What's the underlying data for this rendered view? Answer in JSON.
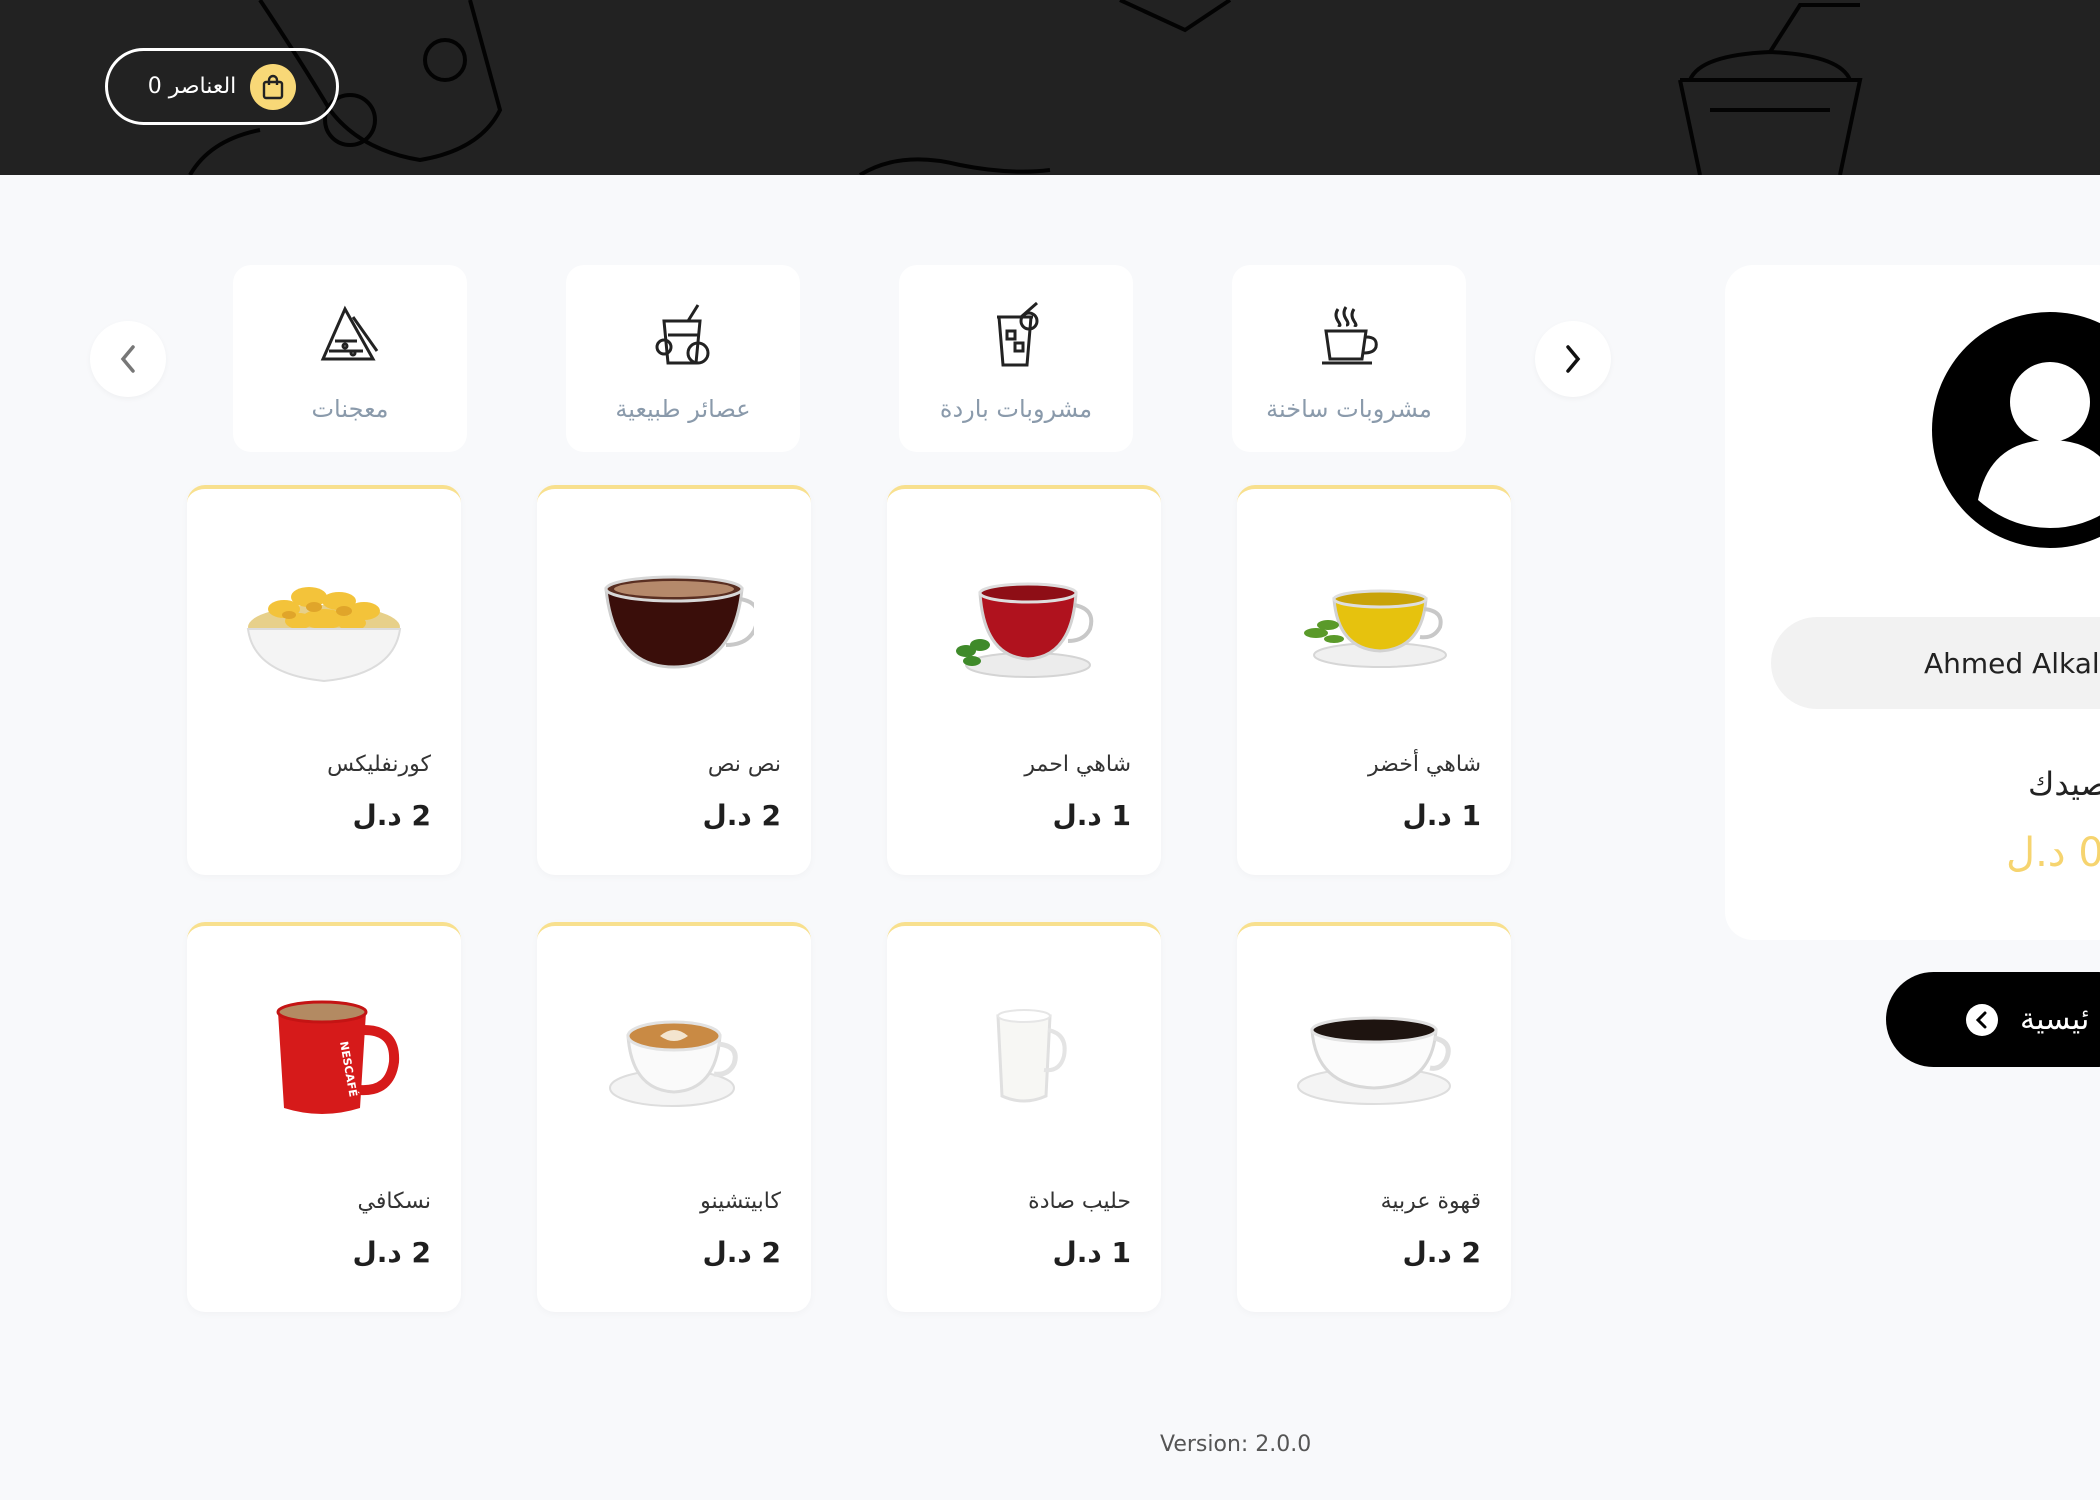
{
  "header": {
    "cart": {
      "label": "العناصر",
      "count": "0"
    }
  },
  "categories": [
    {
      "label": "مشروبات ساخنة",
      "icon": "hot-drink-icon"
    },
    {
      "label": "مشروبات باردة",
      "icon": "cold-drink-icon"
    },
    {
      "label": "عصائر طبيعية",
      "icon": "juice-icon"
    },
    {
      "label": "معجنات",
      "icon": "sandwich-icon"
    }
  ],
  "products": [
    {
      "name": "شاهي أخضر",
      "price": "1 د.ل"
    },
    {
      "name": "شاهي احمر",
      "price": "1 د.ل"
    },
    {
      "name": "نص نص",
      "price": "2 د.ل"
    },
    {
      "name": "كورنفليكس",
      "price": "2 د.ل"
    },
    {
      "name": "قهوة عربية",
      "price": "2 د.ل"
    },
    {
      "name": "حليب صادة",
      "price": "1 د.ل"
    },
    {
      "name": "كابيتشينو",
      "price": "2 د.ل"
    },
    {
      "name": "نسكافي",
      "price": "2 د.ل"
    }
  ],
  "profile": {
    "username": "Ahmed Alkal",
    "balance_label": "رصيدك",
    "balance_value": "0 د.ل"
  },
  "home_button": {
    "label": "ئيسية"
  },
  "footer": {
    "version": "Version: 2.0.0"
  },
  "colors": {
    "accent": "#f6d46f",
    "header_bg": "#222222",
    "page_bg": "#f8f9fb"
  }
}
